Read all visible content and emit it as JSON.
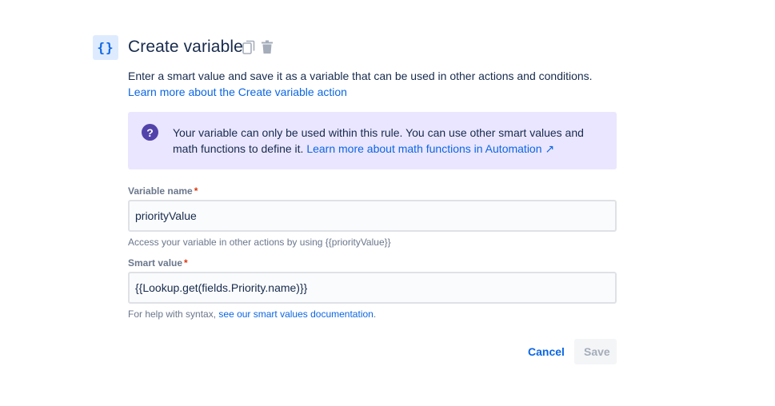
{
  "header": {
    "icon_label": "{}",
    "icon_name": "curly-braces-icon",
    "title": "Create variable",
    "tools": [
      "copy-icon",
      "trash-icon"
    ]
  },
  "description": {
    "text": "Enter a smart value and save it as a variable that can be used in other actions and conditions.",
    "link": "Learn more about the Create variable action"
  },
  "info_panel": {
    "icon": "?",
    "text": "Your variable can only be used within this rule. You can use other smart values and math functions to define it.",
    "link": "Learn more about math functions in Automation ↗"
  },
  "fields": {
    "variable_name": {
      "label": "Variable name",
      "required_mark": "*",
      "value": "priorityValue",
      "helper": "Access your variable in other actions by using {{priorityValue}}"
    },
    "smart_value": {
      "label": "Smart value",
      "required_mark": "*",
      "value": "{{Lookup.get(fields.Priority.name)}}",
      "helper_prefix": "For help with syntax,",
      "helper_link": "see our smart values documentation",
      "helper_suffix": "."
    }
  },
  "actions": {
    "cancel_label": "Cancel",
    "save_label": "Save"
  },
  "colors": {
    "link": "#0c66e4",
    "info_bg": "#eae6ff",
    "info_icon": "#5243aa",
    "required": "#de350b"
  }
}
